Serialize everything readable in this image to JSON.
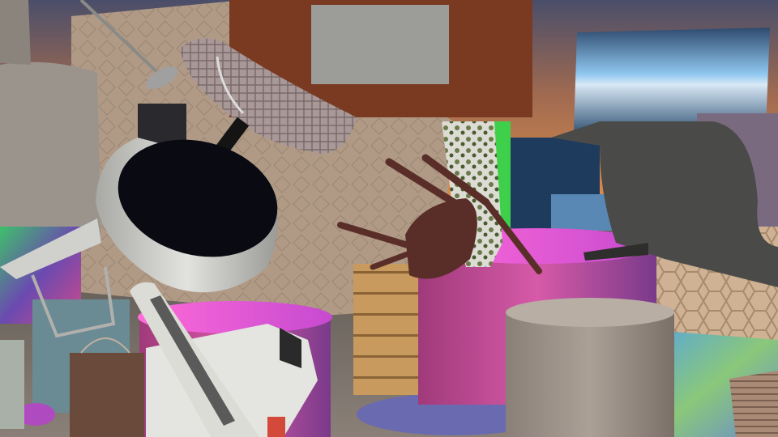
{
  "image": {
    "kind": "synthetic 3D render",
    "objects": [
      {
        "name": "sunset-sky-background"
      },
      {
        "name": "tiled-floor"
      },
      {
        "name": "patterned-wall-panel"
      },
      {
        "name": "beige-cylinder-left"
      },
      {
        "name": "wooden-crate"
      },
      {
        "name": "pink-cylinder-center"
      },
      {
        "name": "gray-cylinder-right"
      },
      {
        "name": "sky-textured-box-top-right"
      },
      {
        "name": "hexagon-tile-box-right"
      },
      {
        "name": "picture-frame-wooden"
      },
      {
        "name": "gray-armchair-upside-down"
      },
      {
        "name": "brown-wooden-chair-tumbling"
      },
      {
        "name": "floor-lamp-plaid-shade"
      },
      {
        "name": "white-cooking-pot"
      },
      {
        "name": "white-van-toy"
      },
      {
        "name": "white-phone-device"
      },
      {
        "name": "paper-shopping-bag"
      },
      {
        "name": "camouflage-figure"
      },
      {
        "name": "pink-cylinder-left"
      },
      {
        "name": "wooden-shutter-box"
      }
    ]
  },
  "palette": {
    "sky_top": "#8a6a5a",
    "sky_glow": "#e09060",
    "wall": "#b49c88",
    "floor": "#6e6660",
    "pink": "#d65aa8",
    "magenta": "#e65ac8",
    "green": "#3ed04a",
    "chair_brown": "#5a2e28",
    "armchair_gray": "#4a4a48",
    "frame_brown": "#7a3a22",
    "frame_canvas": "#9c9c98",
    "pot_white": "#d6d6d2",
    "pot_black": "#0a0a12",
    "van_white": "#e4e4e0",
    "crate_wood": "#c2985e",
    "gray_cylinder": "#a89e94",
    "sky_box": "#6aa4d4",
    "hex_box": "#c6a88a"
  }
}
